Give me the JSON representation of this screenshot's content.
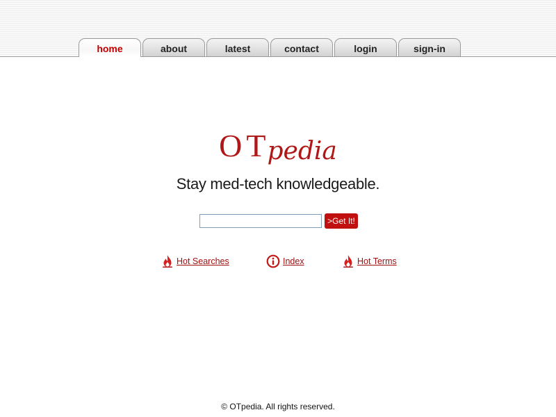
{
  "nav": {
    "tabs": [
      {
        "label": "home",
        "active": true
      },
      {
        "label": "about",
        "active": false
      },
      {
        "label": "latest",
        "active": false
      },
      {
        "label": "contact",
        "active": false
      },
      {
        "label": "login",
        "active": false
      },
      {
        "label": "sign-in",
        "active": false
      }
    ]
  },
  "logo": {
    "part1": "OT",
    "part2": "pedia",
    "color": "#b01818"
  },
  "tagline": "Stay med-tech knowledgeable.",
  "search": {
    "value": "",
    "placeholder": "",
    "button_label": ">Get It!"
  },
  "links": [
    {
      "label": "Hot Searches",
      "icon": "flame-icon"
    },
    {
      "label": "Index",
      "icon": "info-icon"
    },
    {
      "label": "Hot Terms",
      "icon": "flame-icon"
    }
  ],
  "footer": "© OTpedia. All rights reserved.",
  "colors": {
    "accent": "#c00000",
    "link": "#a01010"
  }
}
